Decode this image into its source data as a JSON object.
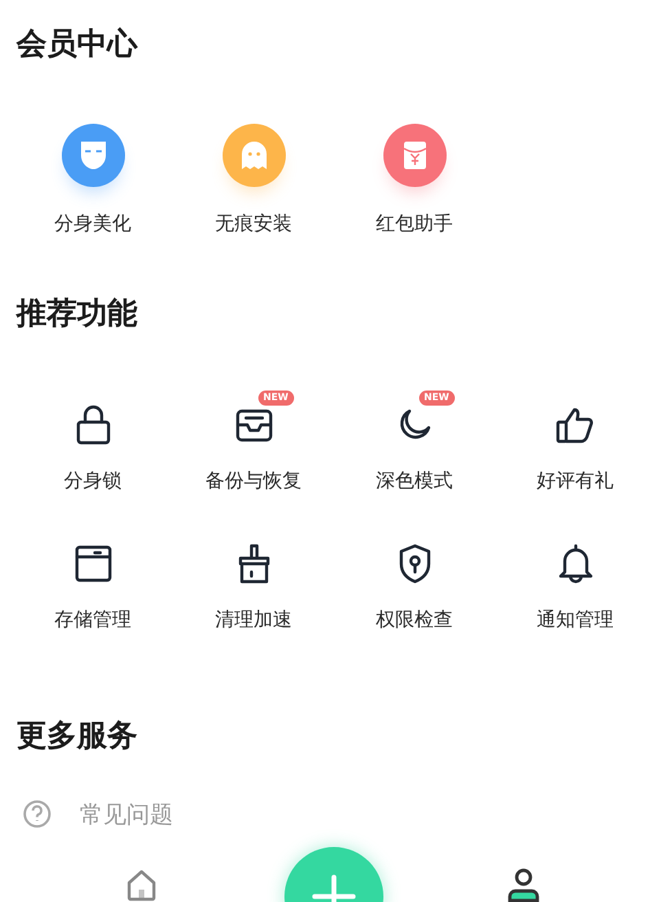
{
  "vip": {
    "title": "会员中心",
    "items": [
      {
        "label": "分身美化",
        "color": "#4a9df5"
      },
      {
        "label": "无痕安装",
        "color": "#fdb54a"
      },
      {
        "label": "红包助手",
        "color": "#f7727a"
      }
    ]
  },
  "features": {
    "title": "推荐功能",
    "items": [
      {
        "label": "分身锁"
      },
      {
        "label": "备份与恢复",
        "badge": "NEW"
      },
      {
        "label": "深色模式",
        "badge": "NEW"
      },
      {
        "label": "好评有礼"
      },
      {
        "label": "存储管理"
      },
      {
        "label": "清理加速"
      },
      {
        "label": "权限检查"
      },
      {
        "label": "通知管理"
      }
    ]
  },
  "more": {
    "title": "更多服务",
    "items": [
      {
        "label": "常见问题"
      }
    ]
  },
  "tab_bar": {
    "tabs": [
      {
        "kind": "home",
        "selected": false
      },
      {
        "kind": "add",
        "selected": false
      },
      {
        "kind": "profile",
        "selected": true
      }
    ]
  }
}
